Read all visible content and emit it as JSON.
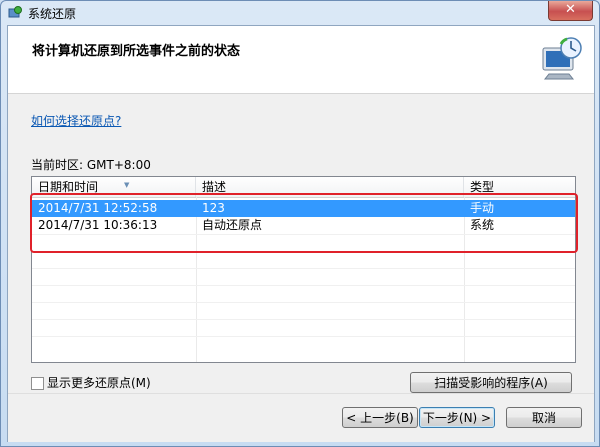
{
  "window": {
    "title": "系统还原",
    "close_label": "✕"
  },
  "header": {
    "title": "将计算机还原到所选事件之前的状态"
  },
  "help_link": "如何选择还原点?",
  "timezone": "当前时区: GMT+8:00",
  "table": {
    "columns": [
      "日期和时间",
      "描述",
      "类型"
    ],
    "rows": [
      {
        "datetime": "2014/7/31 12:52:58",
        "description": "123",
        "type": "手动",
        "selected": true
      },
      {
        "datetime": "2014/7/31 10:36:13",
        "description": "自动还原点",
        "type": "系统",
        "selected": false
      }
    ]
  },
  "show_more": {
    "label": "显示更多还原点(M)",
    "checked": false
  },
  "scan_button": "扫描受影响的程序(A)",
  "footer": {
    "back": "< 上一步(B)",
    "next": "下一步(N) >",
    "cancel": "取消"
  },
  "colors": {
    "selection": "#3399ff",
    "highlight_box": "#e0212a",
    "link": "#0b58b3"
  }
}
